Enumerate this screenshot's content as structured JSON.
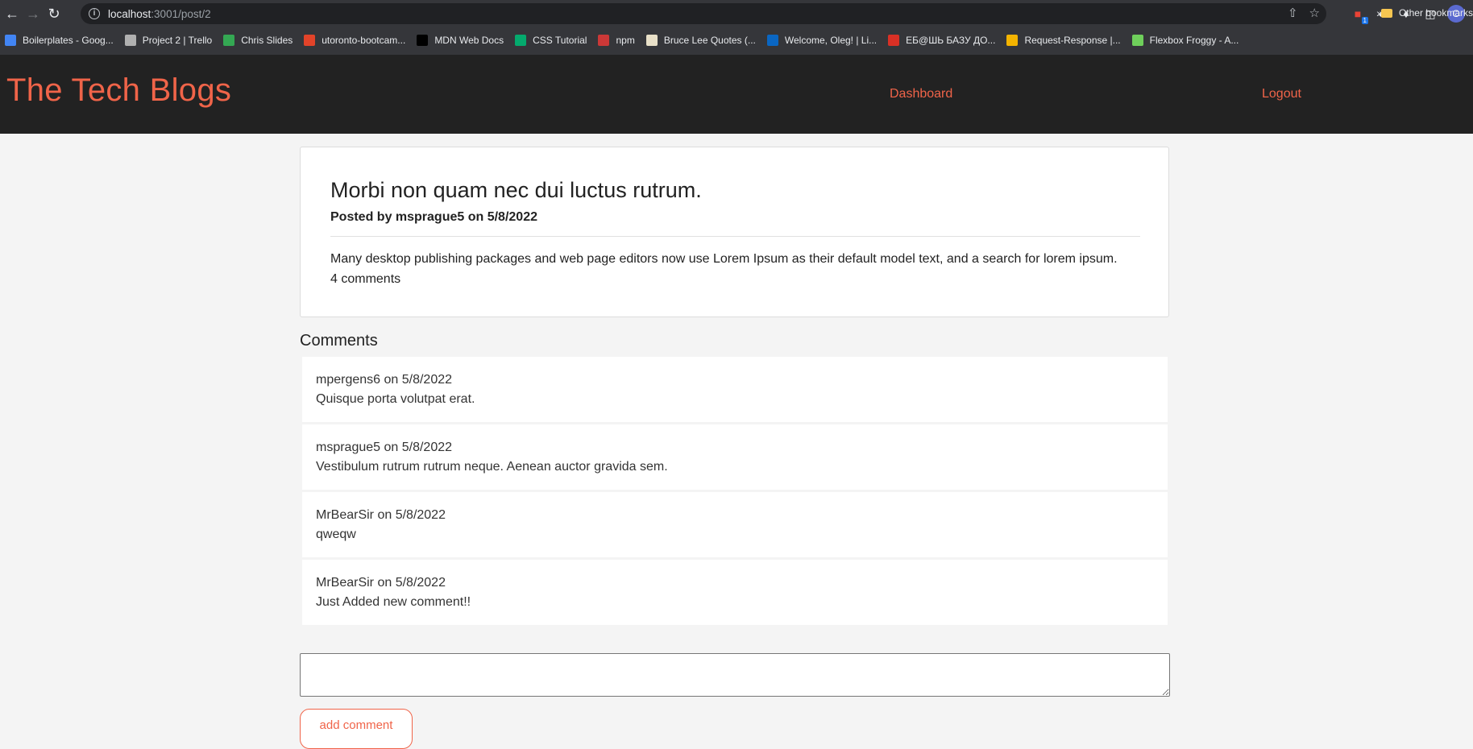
{
  "browser": {
    "url_host": "localhost",
    "url_path": ":3001/post/2",
    "bookmarks": [
      {
        "label": "Boilerplates - Goog...",
        "color": "#4285f4"
      },
      {
        "label": "Project 2 | Trello",
        "color": "#b0b0b0"
      },
      {
        "label": "Chris Slides",
        "color": "#34a853"
      },
      {
        "label": "utoronto-bootcam...",
        "color": "#e24329"
      },
      {
        "label": "MDN Web Docs",
        "color": "#000000"
      },
      {
        "label": "CSS Tutorial",
        "color": "#04aa6d"
      },
      {
        "label": "npm",
        "color": "#cb3837"
      },
      {
        "label": "Bruce Lee Quotes (...",
        "color": "#e8e0c8"
      },
      {
        "label": "Welcome, Oleg! | Li...",
        "color": "#0a66c2"
      },
      {
        "label": "ЕБ@ШЬ БАЗУ ДО...",
        "color": "#d93025"
      },
      {
        "label": "Request-Response |...",
        "color": "#f4b400"
      },
      {
        "label": "Flexbox Froggy - A...",
        "color": "#6fcf5b"
      }
    ],
    "other_bookmarks": "Other bookmarks",
    "profile_initial": "O"
  },
  "site": {
    "title": "The Tech Blogs",
    "nav": {
      "dashboard": "Dashboard",
      "logout": "Logout"
    }
  },
  "post": {
    "title": "Morbi non quam nec dui luctus rutrum.",
    "meta": "Posted by msprague5 on 5/8/2022",
    "body": "Many desktop publishing packages and web page editors now use Lorem Ipsum as their default model text, and a search for lorem ipsum.",
    "comment_count": "4 comments"
  },
  "comments": {
    "heading": "Comments",
    "items": [
      {
        "meta": "mpergens6 on 5/8/2022",
        "text": "Quisque porta volutpat erat."
      },
      {
        "meta": "msprague5 on 5/8/2022",
        "text": "Vestibulum rutrum rutrum neque. Aenean auctor gravida sem."
      },
      {
        "meta": "MrBearSir on 5/8/2022",
        "text": "qweqw"
      },
      {
        "meta": "MrBearSir on 5/8/2022",
        "text": "Just Added new comment!!"
      }
    ]
  },
  "form": {
    "comment_value": "",
    "submit_label": "add comment"
  },
  "colors": {
    "accent": "#f06449",
    "header_bg": "#222222",
    "page_bg": "#f4f4f4"
  }
}
